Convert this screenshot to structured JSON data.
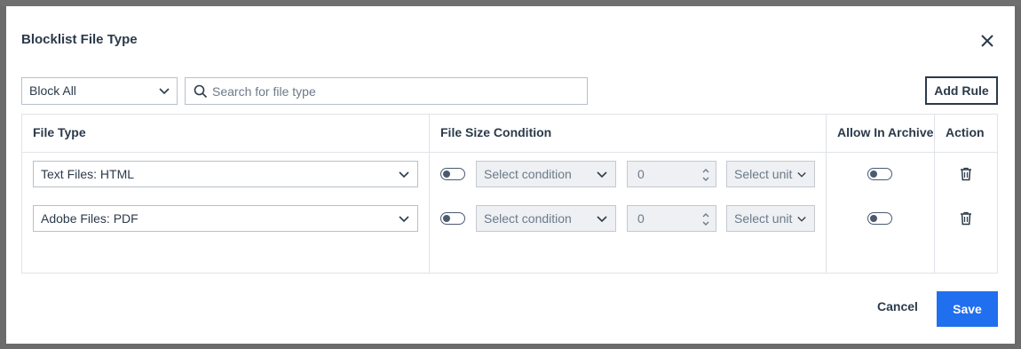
{
  "dialog": {
    "title": "Blocklist File Type"
  },
  "toolbar": {
    "block_select_value": "Block All",
    "search_placeholder": "Search for file type",
    "add_rule_label": "Add Rule"
  },
  "table": {
    "headers": {
      "file_type": "File Type",
      "file_size_condition": "File Size Condition",
      "allow_in_archive": "Allow In Archive",
      "action": "Action"
    },
    "rows": [
      {
        "file_type": "Text Files: HTML",
        "size_condition_enabled": false,
        "condition_placeholder": "Select condition",
        "size_value": "0",
        "unit_placeholder": "Select unit",
        "allow_in_archive": false
      },
      {
        "file_type": "Adobe Files: PDF",
        "size_condition_enabled": false,
        "condition_placeholder": "Select condition",
        "size_value": "0",
        "unit_placeholder": "Select unit",
        "allow_in_archive": false
      }
    ]
  },
  "footer": {
    "cancel_label": "Cancel",
    "save_label": "Save"
  },
  "colors": {
    "primary": "#1f6fef",
    "text": "#2b3a4a",
    "overlay": "#6b6b6b"
  }
}
